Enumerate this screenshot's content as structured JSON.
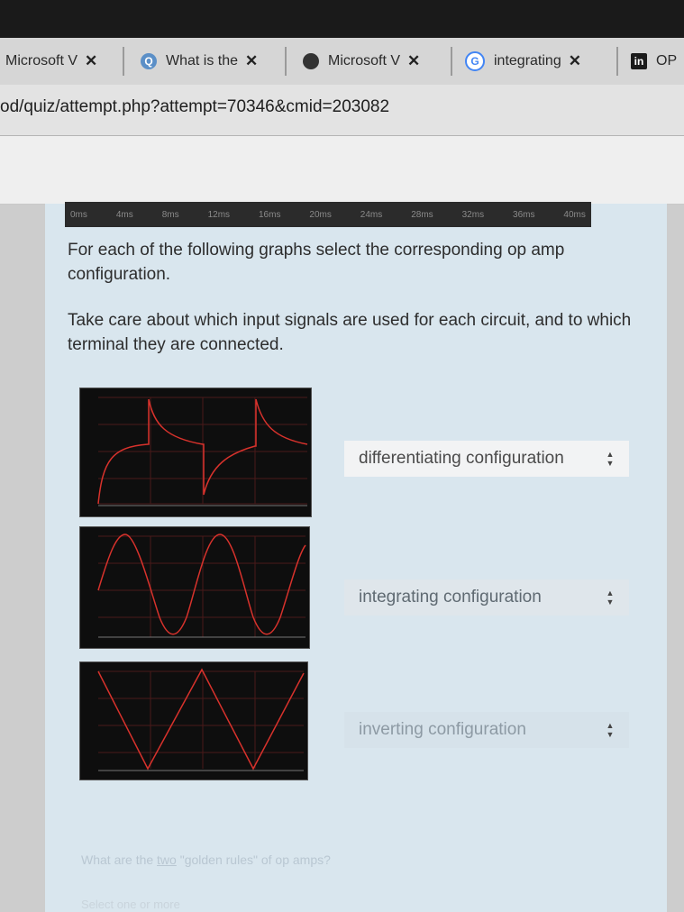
{
  "tabs": [
    {
      "label": "Microsoft V",
      "icon": "none",
      "close": "✕"
    },
    {
      "label": "What is the",
      "icon": "search-icon",
      "close": "✕"
    },
    {
      "label": "Microsoft V",
      "icon": "circle-icon",
      "close": "✕"
    },
    {
      "label": "integrating",
      "icon": "google-icon",
      "close": "✕"
    },
    {
      "label": "OP",
      "icon": "linkedin-icon",
      "close": ""
    }
  ],
  "url": "od/quiz/attempt.php?attempt=70346&cmid=203082",
  "timeline": [
    "0ms",
    "4ms",
    "8ms",
    "12ms",
    "16ms",
    "20ms",
    "24ms",
    "28ms",
    "32ms",
    "36ms",
    "40ms"
  ],
  "question": {
    "line1": "For each of the following graphs select the corresponding op amp configuration.",
    "line2": "Take care about which input signals are used for each circuit, and to which terminal they are connected."
  },
  "answers": [
    {
      "selected": "differentiating configuration",
      "arrows": "▲▼"
    },
    {
      "selected": "integrating configuration",
      "arrows": "▲▼"
    },
    {
      "selected": "inverting configuration",
      "arrows": "▲▼"
    }
  ],
  "next_question": {
    "before": "What are the ",
    "link": "two",
    "after": " \"golden rules\" of op amps?"
  },
  "next_hint": "Select one or more",
  "colors": {
    "trace": "#d8322c",
    "grid": "#5a1e1e",
    "graph_bg": "#0e0e0e"
  }
}
